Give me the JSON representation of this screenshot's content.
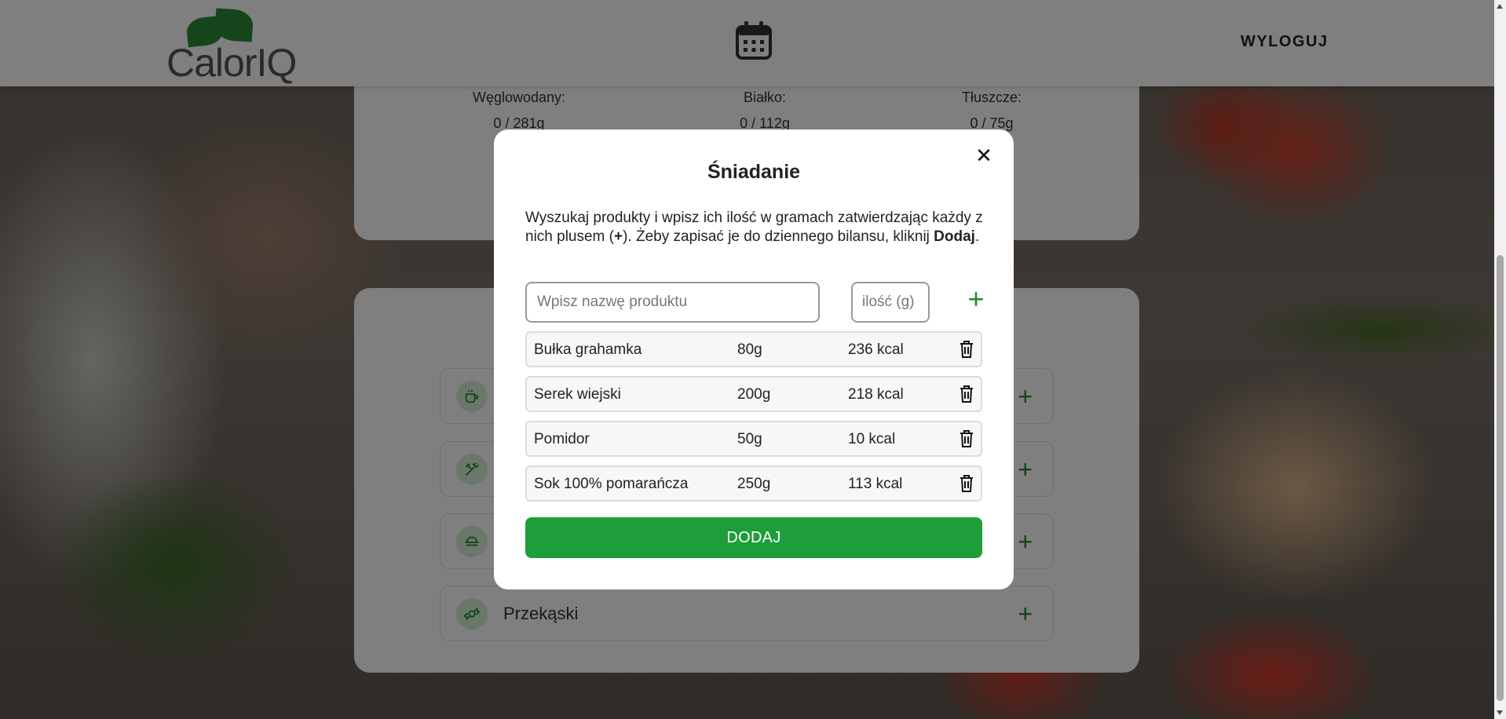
{
  "header": {
    "logo_text": "CalorIQ",
    "calendar_icon": "calendar-icon",
    "logout_label": "WYLOGUJ"
  },
  "macros": [
    {
      "label": "Węglowodany:",
      "value": "0 / 281g"
    },
    {
      "label": "Białko:",
      "value": "0 / 112g"
    },
    {
      "label": "Tłuszcze:",
      "value": "0 / 75g"
    }
  ],
  "meals": [
    {
      "name": "",
      "icon": "coffee-icon"
    },
    {
      "name": "",
      "icon": "utensils-icon"
    },
    {
      "name": "",
      "icon": "food-container-icon"
    },
    {
      "name": "Przekąski",
      "icon": "candy-icon"
    }
  ],
  "modal": {
    "title": "Śniadanie",
    "description_prefix": "Wyszukaj produkty i wpisz ich ilość w gramach zatwierdzając każdy z nich plusem (",
    "description_plus": "+",
    "description_middle": "). Żeby zapisać je do dziennego bilansu, kliknij ",
    "description_bold": "Dodaj",
    "description_suffix": ".",
    "product_placeholder": "Wpisz nazwę produktu",
    "quantity_placeholder": "ilość (g)",
    "products": [
      {
        "name": "Bułka grahamka",
        "qty": "80g",
        "kcal": "236 kcal"
      },
      {
        "name": "Serek wiejski",
        "qty": "200g",
        "kcal": "218 kcal"
      },
      {
        "name": "Pomidor",
        "qty": "50g",
        "kcal": "10 kcal"
      },
      {
        "name": "Sok 100% pomarańcza",
        "qty": "250g",
        "kcal": "113 kcal"
      }
    ],
    "submit_label": "DODAJ"
  },
  "colors": {
    "accent": "#1e9e3a",
    "accent_icon": "#1f8a2d",
    "overlay": "rgba(0,0,0,0.5)"
  }
}
